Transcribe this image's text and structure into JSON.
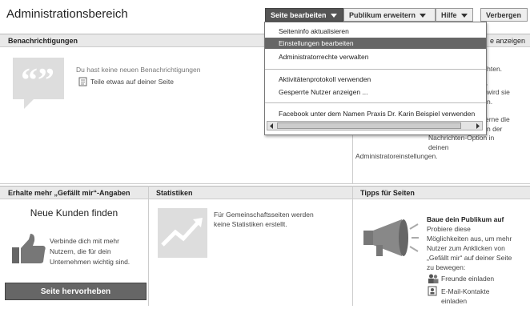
{
  "header": {
    "title": "Administrationsbereich",
    "btn_page": "Seite bearbeiten",
    "btn_audience": "Publikum erweitern",
    "btn_help": "Hilfe",
    "btn_hide": "Verbergen"
  },
  "menu": {
    "items": [
      "Seiteninfo aktualisieren",
      "Einstellungen bearbeiten",
      "Administratorrechte verwalten",
      "Aktivitätenprotokoll verwenden",
      "Gesperrte Nutzer anzeigen ...",
      "Facebook unter dem Namen Praxis Dr. Karin Beispiel verwenden"
    ]
  },
  "notifications": {
    "header": "Benachrichtigungen",
    "empty": "Du hast keine neuen Benachrichtigungen",
    "share": "Teile etwas auf deiner Seite"
  },
  "right_panel": {
    "header_tail": "e anzeigen",
    "lines": [
      "ichten.",
      "n,",
      "wird sie",
      "n.",
      "erne die",
      "n der"
    ],
    "bottom_lines": [
      "Nachrichten-Option in",
      "deinen",
      "Administratoreinstellungen."
    ]
  },
  "likes": {
    "header": "Erhalte mehr „Gefällt mir“-Angaben",
    "heading": "Neue Kunden finden",
    "desc_1": "Verbinde dich mit mehr",
    "desc_2": "Nutzern, die für dein",
    "desc_3": "Unternehmen wichtig sind.",
    "button": "Seite hervorheben"
  },
  "stats": {
    "header": "Statistiken",
    "text_1": "Für Gemeinschaftsseiten werden",
    "text_2": "keine Statistiken erstellt."
  },
  "tips": {
    "header": "Tipps für Seiten",
    "heading": "Baue dein Publikum auf",
    "lines": [
      "Probiere diese",
      "Möglichkeiten aus, um mehr",
      "Nutzer zum Anklicken von",
      "„Gefällt mir“ auf deiner Seite",
      "zu bewegen:"
    ],
    "invite_friends": "Freunde einladen",
    "invite_email_1": "E-Mail-Kontakte",
    "invite_email_2": "einladen"
  }
}
